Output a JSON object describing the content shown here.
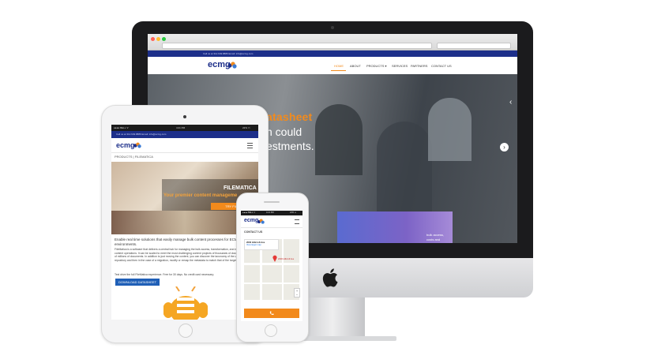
{
  "desktop": {
    "topbar_text": "Call us at 312.649.8886   Email: info@ecmg.com",
    "logo": "ecmg",
    "nav": [
      "HOME",
      "ABOUT",
      "PRODUCTS ▾",
      "SERVICES",
      "PARTNERS",
      "CONTACT US"
    ],
    "hero_title": "atasheet",
    "hero_line2": "n could",
    "hero_line3": "estments.",
    "overlay_lines": [
      "bulk access,",
      "costs and"
    ]
  },
  "tablet": {
    "status_left": "●●●● BELL ᯤ",
    "status_time": "4:21 PM",
    "status_right": "22% ▭",
    "topbar_text": "Call us at 312.649.8886   Email: info@ecmg.com",
    "logo": "ecmg",
    "breadcrumb": "PRODUCTS | FILEMATICA",
    "hero_title": "FILEMATICA",
    "hero_subtitle": "Your premier content manageme",
    "hero_button": "TRY FILEMA",
    "lead": "Enable real time solutions that easily manage bulk content processes for ECM environments.",
    "para1": "FileMatica is a software that delivers a central hub for managing the bulk access, transformation, and monitoring of content operations. It can be scaled to meet the most challenging content projects of thousands of documents to tens of millions of documents. In addition to just moving the content, you can discover the taxonomy of the underlying repository and then in the case of a migration, modify or remap the metadata to match that of the target repository.",
    "para2": "Test drive the full FileMatica experience. Free for 30 days. No credit card necessary.",
    "download_button": "DOWNLOAD DATASHEET"
  },
  "phone": {
    "status_left": "●●●● BELL ᯤ",
    "status_time": "4:21 PM",
    "status_right": "22% ▭",
    "logo": "ecmg",
    "section_title": "CONTACT US",
    "map_address": "2000 Hillcroft Ave",
    "map_link": "View larger map",
    "map_marker_label": "2000 Hillcroft Ave",
    "call_icon": "phone-icon"
  },
  "colors": {
    "navy": "#1d2f8a",
    "orange": "#f28a1c",
    "blue_button": "#1f5fb7"
  }
}
